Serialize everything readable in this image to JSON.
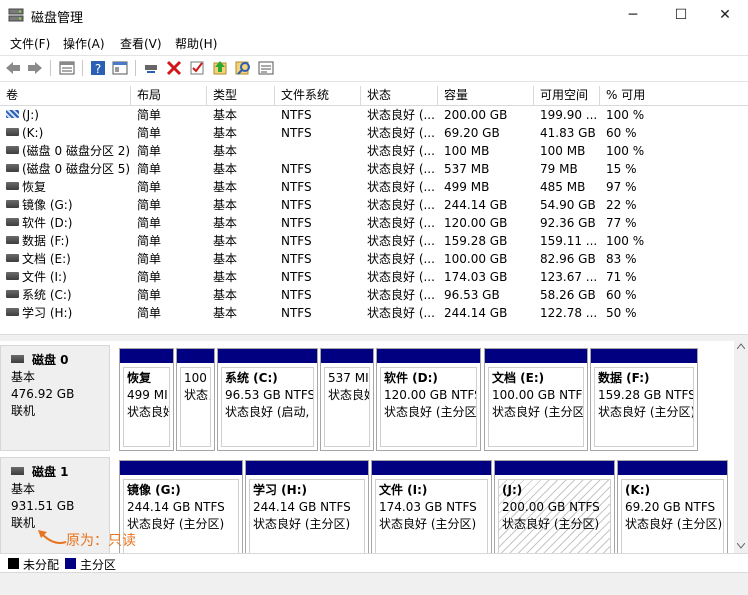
{
  "window": {
    "title": "磁盘管理",
    "minimize": "─",
    "maximize": "☐",
    "close": "✕"
  },
  "menu": [
    "文件(F)",
    "操作(A)",
    "查看(V)",
    "帮助(H)"
  ],
  "toolbar_icons": [
    "back-icon",
    "forward-icon",
    "properties-icon",
    "help-icon",
    "view-icon",
    "connect-icon",
    "delete-icon",
    "check-icon",
    "up-icon",
    "search-icon",
    "list-icon"
  ],
  "table": {
    "headers": [
      "卷",
      "布局",
      "类型",
      "文件系统",
      "状态",
      "容量",
      "可用空间",
      "% 可用"
    ],
    "rows": [
      {
        "vol": "(J:)",
        "layout": "简单",
        "type": "基本",
        "fs": "NTFS",
        "status": "状态良好 (...",
        "cap": "200.00 GB",
        "free": "199.90 ...",
        "pct": "100 %"
      },
      {
        "vol": "(K:)",
        "layout": "简单",
        "type": "基本",
        "fs": "NTFS",
        "status": "状态良好 (...",
        "cap": "69.20 GB",
        "free": "41.83 GB",
        "pct": "60 %"
      },
      {
        "vol": "(磁盘 0 磁盘分区 2)",
        "layout": "简单",
        "type": "基本",
        "fs": "",
        "status": "状态良好 (...",
        "cap": "100 MB",
        "free": "100 MB",
        "pct": "100 %"
      },
      {
        "vol": "(磁盘 0 磁盘分区 5)",
        "layout": "简单",
        "type": "基本",
        "fs": "NTFS",
        "status": "状态良好 (...",
        "cap": "537 MB",
        "free": "79 MB",
        "pct": "15 %"
      },
      {
        "vol": "恢复",
        "layout": "简单",
        "type": "基本",
        "fs": "NTFS",
        "status": "状态良好 (...",
        "cap": "499 MB",
        "free": "485 MB",
        "pct": "97 %"
      },
      {
        "vol": "镜像 (G:)",
        "layout": "简单",
        "type": "基本",
        "fs": "NTFS",
        "status": "状态良好 (...",
        "cap": "244.14 GB",
        "free": "54.90 GB",
        "pct": "22 %"
      },
      {
        "vol": "软件 (D:)",
        "layout": "简单",
        "type": "基本",
        "fs": "NTFS",
        "status": "状态良好 (...",
        "cap": "120.00 GB",
        "free": "92.36 GB",
        "pct": "77 %"
      },
      {
        "vol": "数据 (F:)",
        "layout": "简单",
        "type": "基本",
        "fs": "NTFS",
        "status": "状态良好 (...",
        "cap": "159.28 GB",
        "free": "159.11 ...",
        "pct": "100 %"
      },
      {
        "vol": "文档 (E:)",
        "layout": "简单",
        "type": "基本",
        "fs": "NTFS",
        "status": "状态良好 (...",
        "cap": "100.00 GB",
        "free": "82.96 GB",
        "pct": "83 %"
      },
      {
        "vol": "文件 (I:)",
        "layout": "简单",
        "type": "基本",
        "fs": "NTFS",
        "status": "状态良好 (...",
        "cap": "174.03 GB",
        "free": "123.67 ...",
        "pct": "71 %"
      },
      {
        "vol": "系统 (C:)",
        "layout": "简单",
        "type": "基本",
        "fs": "NTFS",
        "status": "状态良好 (...",
        "cap": "96.53 GB",
        "free": "58.26 GB",
        "pct": "60 %"
      },
      {
        "vol": "学习 (H:)",
        "layout": "简单",
        "type": "基本",
        "fs": "NTFS",
        "status": "状态良好 (...",
        "cap": "244.14 GB",
        "free": "122.78 ...",
        "pct": "50 %"
      }
    ]
  },
  "disks": [
    {
      "name": "磁盘 0",
      "type": "基本",
      "size": "476.92 GB",
      "state": "联机",
      "partitions": [
        {
          "name": "恢复",
          "size": "499 MI",
          "status": "状态良好"
        },
        {
          "name": "",
          "size": "100",
          "status": "状态良"
        },
        {
          "name": "系统  (C:)",
          "size": "96.53 GB NTFS",
          "status": "状态良好 (启动, )"
        },
        {
          "name": "",
          "size": "537 MI",
          "status": "状态良好"
        },
        {
          "name": "软件  (D:)",
          "size": "120.00 GB NTFS",
          "status": "状态良好 (主分区)"
        },
        {
          "name": "文档  (E:)",
          "size": "100.00 GB NTFS",
          "status": "状态良好 (主分区)"
        },
        {
          "name": "数据  (F:)",
          "size": "159.28 GB NTFS",
          "status": "状态良好 (主分区)"
        }
      ]
    },
    {
      "name": "磁盘 1",
      "type": "基本",
      "size": "931.51 GB",
      "state": "联机",
      "partitions": [
        {
          "name": "镜像  (G:)",
          "size": "244.14 GB NTFS",
          "status": "状态良好 (主分区)"
        },
        {
          "name": "学习  (H:)",
          "size": "244.14 GB NTFS",
          "status": "状态良好 (主分区)"
        },
        {
          "name": "文件  (I:)",
          "size": "174.03 GB NTFS",
          "status": "状态良好 (主分区)"
        },
        {
          "name": "(J:)",
          "size": "200.00 GB NTFS",
          "status": "状态良好 (主分区)"
        },
        {
          "name": "(K:)",
          "size": "69.20 GB NTFS",
          "status": "状态良好 (主分区)"
        }
      ]
    }
  ],
  "annotation": "原为：只读",
  "legend": [
    {
      "label": "未分配",
      "color": "#000000"
    },
    {
      "label": "主分区",
      "color": "#000080"
    }
  ]
}
